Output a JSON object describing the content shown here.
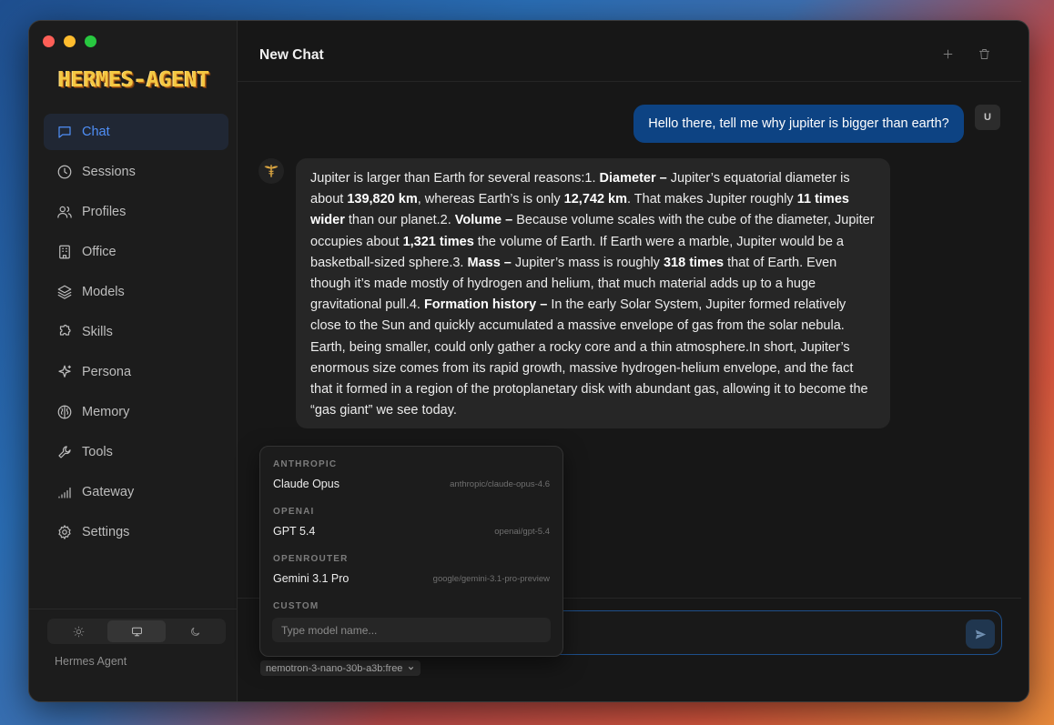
{
  "app": {
    "logo_text": "HERMES-AGENT",
    "footer_label": "Hermes Agent"
  },
  "sidebar": {
    "items": [
      {
        "label": "Chat",
        "icon": "chat-bubble-icon",
        "active": true
      },
      {
        "label": "Sessions",
        "icon": "clock-icon",
        "active": false
      },
      {
        "label": "Profiles",
        "icon": "users-icon",
        "active": false
      },
      {
        "label": "Office",
        "icon": "building-icon",
        "active": false
      },
      {
        "label": "Models",
        "icon": "layers-icon",
        "active": false
      },
      {
        "label": "Skills",
        "icon": "puzzle-icon",
        "active": false
      },
      {
        "label": "Persona",
        "icon": "sparkle-icon",
        "active": false
      },
      {
        "label": "Memory",
        "icon": "brain-icon",
        "active": false
      },
      {
        "label": "Tools",
        "icon": "wrench-icon",
        "active": false
      },
      {
        "label": "Gateway",
        "icon": "signal-bars-icon",
        "active": false
      },
      {
        "label": "Settings",
        "icon": "gear-icon",
        "active": false
      }
    ],
    "theme_options": [
      "light",
      "system",
      "dark"
    ],
    "theme_selected": "system"
  },
  "header": {
    "title": "New Chat"
  },
  "conversation": {
    "user_message": "Hello there, tell me why jupiter is bigger than earth?",
    "user_avatar": "U",
    "assistant_message_segments": [
      {
        "text": "Jupiter is larger than Earth for several reasons:1. ",
        "bold": false
      },
      {
        "text": "Diameter –",
        "bold": true
      },
      {
        "text": " Jupiter’s equatorial diameter is about ",
        "bold": false
      },
      {
        "text": "139,820 km",
        "bold": true
      },
      {
        "text": ", whereas Earth’s is only ",
        "bold": false
      },
      {
        "text": "12,742 km",
        "bold": true
      },
      {
        "text": ". That makes Jupiter roughly ",
        "bold": false
      },
      {
        "text": "11 times wider",
        "bold": true
      },
      {
        "text": " than our planet.2. ",
        "bold": false
      },
      {
        "text": "Volume –",
        "bold": true
      },
      {
        "text": " Because volume scales with the cube of the diameter, Jupiter occupies about ",
        "bold": false
      },
      {
        "text": "1,321 times",
        "bold": true
      },
      {
        "text": " the volume of Earth. If Earth were a marble, Jupiter would be a basketball-sized sphere.3. ",
        "bold": false
      },
      {
        "text": "Mass –",
        "bold": true
      },
      {
        "text": " Jupiter’s mass is roughly ",
        "bold": false
      },
      {
        "text": "318 times",
        "bold": true
      },
      {
        "text": " that of Earth. Even though it’s made mostly of hydrogen and helium, that much material adds up to a huge gravitational pull.4. ",
        "bold": false
      },
      {
        "text": "Formation history –",
        "bold": true
      },
      {
        "text": " In the early Solar System, Jupiter formed relatively close to the Sun and quickly accumulated a massive envelope of gas from the solar nebula. Earth, being smaller, could only gather a rocky core and a thin atmosphere.In short, Jupiter’s enormous size comes from its rapid growth, massive hydrogen-helium envelope, and the fact that it formed in a region of the protoplanetary disk with abundant gas, allowing it to become the “gas giant” we see today.",
        "bold": false
      }
    ]
  },
  "model_picker": {
    "current_model": "nemotron-3-nano-30b-a3b:free",
    "groups": [
      {
        "label": "ANTHROPIC",
        "options": [
          {
            "name": "Claude Opus",
            "id": "anthropic/claude-opus-4.6"
          }
        ]
      },
      {
        "label": "OPENAI",
        "options": [
          {
            "name": "GPT 5.4",
            "id": "openai/gpt-5.4"
          }
        ]
      },
      {
        "label": "OPENROUTER",
        "options": [
          {
            "name": "Gemini 3.1 Pro",
            "id": "google/gemini-3.1-pro-preview"
          }
        ]
      }
    ],
    "custom_label": "CUSTOM",
    "custom_placeholder": "Type model name..."
  },
  "colors": {
    "accent": "#4f8ff7",
    "user_bubble": "#0d4383",
    "window_bg": "#171717",
    "sidebar_bg": "#1c1c1c"
  }
}
